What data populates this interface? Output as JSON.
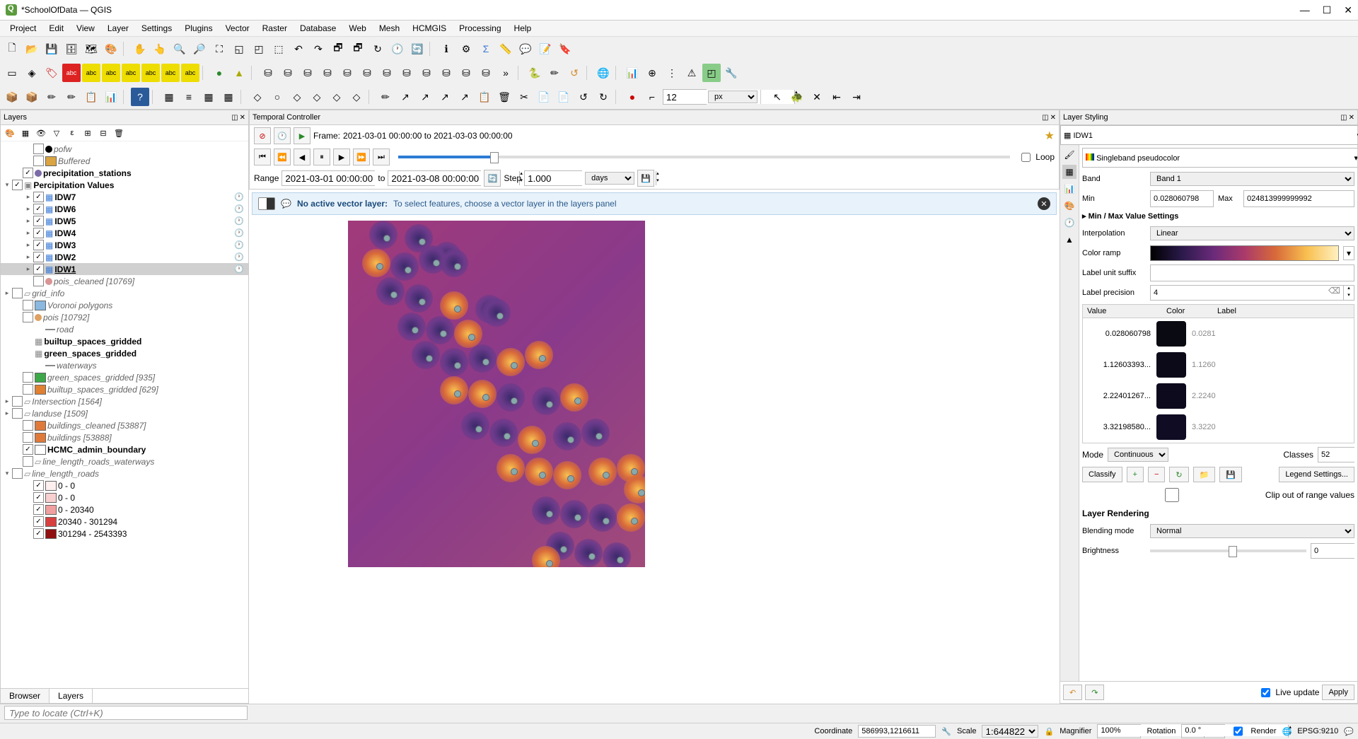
{
  "window": {
    "title": "*SchoolOfData — QGIS"
  },
  "menu": [
    "Project",
    "Edit",
    "View",
    "Layer",
    "Settings",
    "Plugins",
    "Vector",
    "Raster",
    "Database",
    "Web",
    "Mesh",
    "HCMGIS",
    "Processing",
    "Help"
  ],
  "panels": {
    "layers": {
      "title": "Layers"
    },
    "temporal": {
      "title": "Temporal Controller",
      "frame_label": "Frame:",
      "frame_range": "2021-03-01 00:00:00 to 2021-03-03 00:00:00",
      "range_label": "Range",
      "range_from": "2021-03-01 00:00:00",
      "range_to_label": "to",
      "range_to": "2021-03-08 00:00:00",
      "step_label": "Step",
      "step_val": "1.000",
      "step_unit": "days",
      "loop": "Loop"
    },
    "styling": {
      "title": "Layer Styling"
    }
  },
  "layers_tree": [
    {
      "pad": 30,
      "check": false,
      "swatch": "#000",
      "shape": "dot",
      "name": "pofw",
      "italic": true
    },
    {
      "pad": 30,
      "check": false,
      "swatch": "#d9a441",
      "name": "Buffered",
      "italic": true
    },
    {
      "pad": 15,
      "expand": "",
      "check": true,
      "swatch": "#7a6ba8",
      "shape": "dot",
      "name": "precipitation_stations",
      "bold": true
    },
    {
      "pad": 0,
      "expand": "▾",
      "check": true,
      "icon": "group",
      "name": "Percipitation Values",
      "bold": true
    },
    {
      "pad": 30,
      "expand": "▸",
      "check": true,
      "icon": "raster",
      "name": "IDW7",
      "bold": true,
      "clock": true
    },
    {
      "pad": 30,
      "expand": "▸",
      "check": true,
      "icon": "raster",
      "name": "IDW6",
      "bold": true,
      "clock": true
    },
    {
      "pad": 30,
      "expand": "▸",
      "check": true,
      "icon": "raster",
      "name": "IDW5",
      "bold": true,
      "clock": true
    },
    {
      "pad": 30,
      "expand": "▸",
      "check": true,
      "icon": "raster",
      "name": "IDW4",
      "bold": true,
      "clock": true
    },
    {
      "pad": 30,
      "expand": "▸",
      "check": true,
      "icon": "raster",
      "name": "IDW3",
      "bold": true,
      "clock": true
    },
    {
      "pad": 30,
      "expand": "▸",
      "check": true,
      "icon": "raster",
      "name": "IDW2",
      "bold": true,
      "clock": true
    },
    {
      "pad": 30,
      "expand": "▸",
      "check": true,
      "icon": "raster",
      "name": "IDW1",
      "bold": true,
      "clock": true,
      "selected": true,
      "underline": true
    },
    {
      "pad": 30,
      "check": false,
      "swatch": "#d99494",
      "shape": "dot",
      "name": "pois_cleaned [10769]",
      "italic": true
    },
    {
      "pad": 0,
      "expand": "▸",
      "check": false,
      "icon": "vector",
      "name": "grid_info",
      "italic": true
    },
    {
      "pad": 15,
      "check": false,
      "swatch": "#8ab8e0",
      "name": "Voronoi polygons",
      "italic": true
    },
    {
      "pad": 15,
      "check": false,
      "swatch": "#e0a060",
      "shape": "dot",
      "name": "pois [10792]",
      "italic": true
    },
    {
      "pad": 30,
      "swatch": "line",
      "name": "road",
      "italic": true
    },
    {
      "pad": 15,
      "icon": "table",
      "name": "builtup_spaces_gridded",
      "bold": true
    },
    {
      "pad": 15,
      "icon": "table",
      "name": "green_spaces_gridded",
      "bold": true
    },
    {
      "pad": 30,
      "swatch": "line",
      "name": "waterways",
      "italic": true
    },
    {
      "pad": 15,
      "check": false,
      "swatch": "#3ca847",
      "name": "green_spaces_gridded [935]",
      "italic": true
    },
    {
      "pad": 15,
      "check": false,
      "swatch": "#e08030",
      "name": "builtup_spaces_gridded [629]",
      "italic": true
    },
    {
      "pad": 0,
      "expand": "▸",
      "check": false,
      "icon": "vector",
      "name": "Intersection [1564]",
      "italic": true
    },
    {
      "pad": 0,
      "expand": "▸",
      "check": false,
      "icon": "vector",
      "name": "landuse [1509]",
      "italic": true
    },
    {
      "pad": 15,
      "check": false,
      "swatch": "#e07a3a",
      "name": "buildings_cleaned [53887]",
      "italic": true
    },
    {
      "pad": 15,
      "check": false,
      "swatch": "#e07a3a",
      "name": "buildings [53888]",
      "italic": true
    },
    {
      "pad": 15,
      "check": true,
      "swatch": "#fff",
      "name": "HCMC_admin_boundary",
      "bold": true
    },
    {
      "pad": 15,
      "check": false,
      "icon": "vector",
      "name": "line_length_roads_waterways",
      "italic": true
    },
    {
      "pad": 0,
      "expand": "▾",
      "check": false,
      "icon": "vector",
      "name": "line_length_roads",
      "italic": true
    },
    {
      "pad": 30,
      "check": true,
      "swatch": "#fff0f0",
      "name": "0 - 0"
    },
    {
      "pad": 30,
      "check": true,
      "swatch": "#f8d0d0",
      "name": "0 - 0"
    },
    {
      "pad": 30,
      "check": true,
      "swatch": "#f0a0a0",
      "name": "0 - 20340"
    },
    {
      "pad": 30,
      "check": true,
      "swatch": "#d84040",
      "name": "20340 - 301294"
    },
    {
      "pad": 30,
      "check": true,
      "swatch": "#901010",
      "name": "301294 - 2543393"
    }
  ],
  "layer_tabs": {
    "browser": "Browser",
    "layers": "Layers"
  },
  "info_bar": {
    "title": "No active vector layer:",
    "msg": "To select features, choose a vector layer in the layers panel"
  },
  "styling": {
    "layer": "IDW1",
    "renderer": "Singleband pseudocolor",
    "band_label": "Band",
    "band": "Band 1",
    "min_label": "Min",
    "min": "0.028060798",
    "max_label": "Max",
    "max": "024813999999992",
    "minmax_settings": "Min / Max Value Settings",
    "interp_label": "Interpolation",
    "interp": "Linear",
    "ramp_label": "Color ramp",
    "suffix_label": "Label unit suffix",
    "suffix": "",
    "precision_label": "Label precision",
    "precision": "4",
    "table_headers": {
      "value": "Value",
      "color": "Color",
      "label": "Label"
    },
    "color_rows": [
      {
        "val": "0.028060798",
        "color": "#0a0a12",
        "label": "0.0281"
      },
      {
        "val": "1.12603393...",
        "color": "#0c0a18",
        "label": "1.1260"
      },
      {
        "val": "2.22401267...",
        "color": "#0e0a1e",
        "label": "2.2240"
      },
      {
        "val": "3.32198580...",
        "color": "#100c24",
        "label": "3.3220"
      }
    ],
    "mode_label": "Mode",
    "mode": "Continuous",
    "classes_label": "Classes",
    "classes": "52",
    "classify": "Classify",
    "legend_settings": "Legend Settings...",
    "clip_label": "Clip out of range values",
    "rendering_header": "Layer Rendering",
    "blend_label": "Blending mode",
    "blend": "Normal",
    "brightness_label": "Brightness",
    "brightness": "0",
    "live_update": "Live update",
    "apply": "Apply"
  },
  "statusbar": {
    "coord_label": "Coordinate",
    "coord": "586993,1216611",
    "scale_label": "Scale",
    "scale": "1:644822",
    "mag_label": "Magnifier",
    "mag": "100%",
    "rot_label": "Rotation",
    "rot": "0.0 °",
    "render": "Render",
    "epsg": "EPSG:9210"
  },
  "locator_placeholder": "Type to locate (Ctrl+K)",
  "row3_input": "12",
  "row3_unit": "px"
}
